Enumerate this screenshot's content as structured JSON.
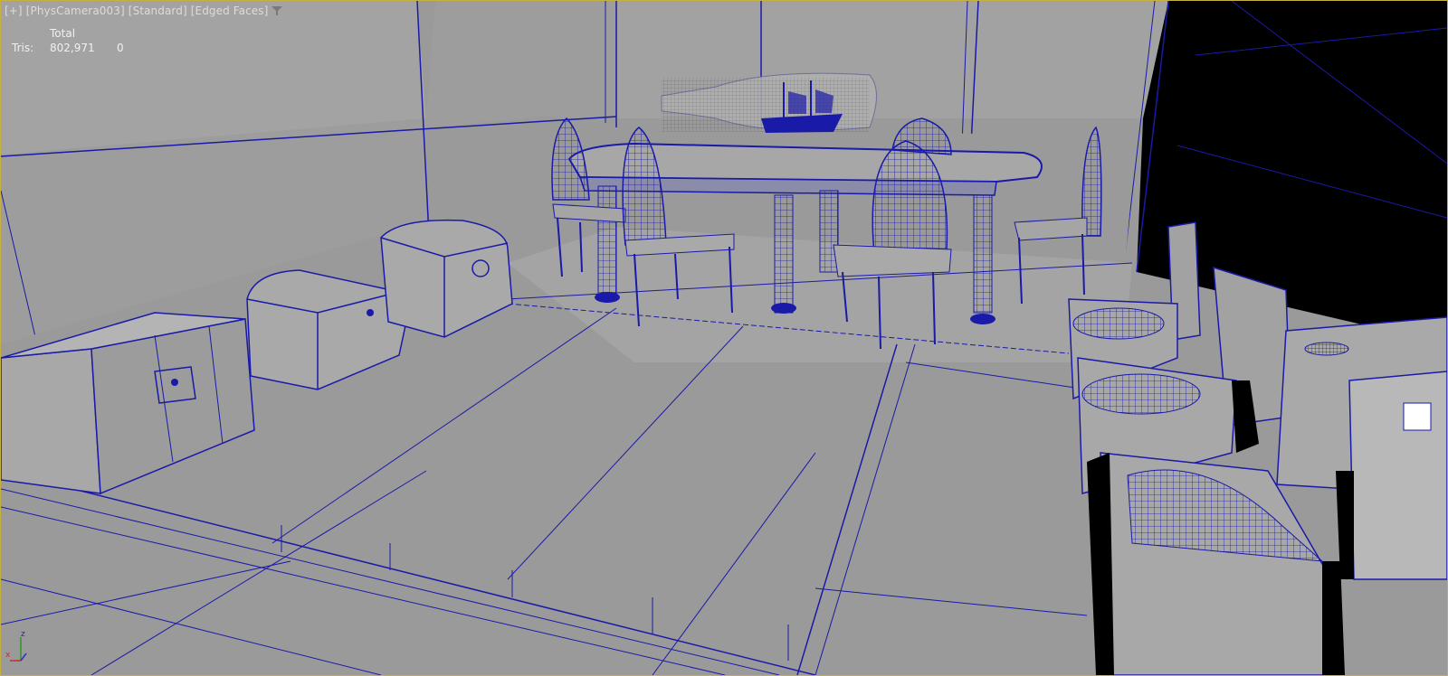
{
  "viewport": {
    "labels": [
      "[+]",
      "[PhysCamera003]",
      "[Standard]",
      "[Edged Faces]"
    ],
    "filter_icon": "funnel-icon",
    "border_color": "#c8b040",
    "wire_color": "#1a1aa8"
  },
  "stats": {
    "header": "Total",
    "tris_label": "Tris:",
    "tris_total": "802,971",
    "tris_selected": "0"
  },
  "gizmo": {
    "x": "x",
    "z": "z"
  }
}
